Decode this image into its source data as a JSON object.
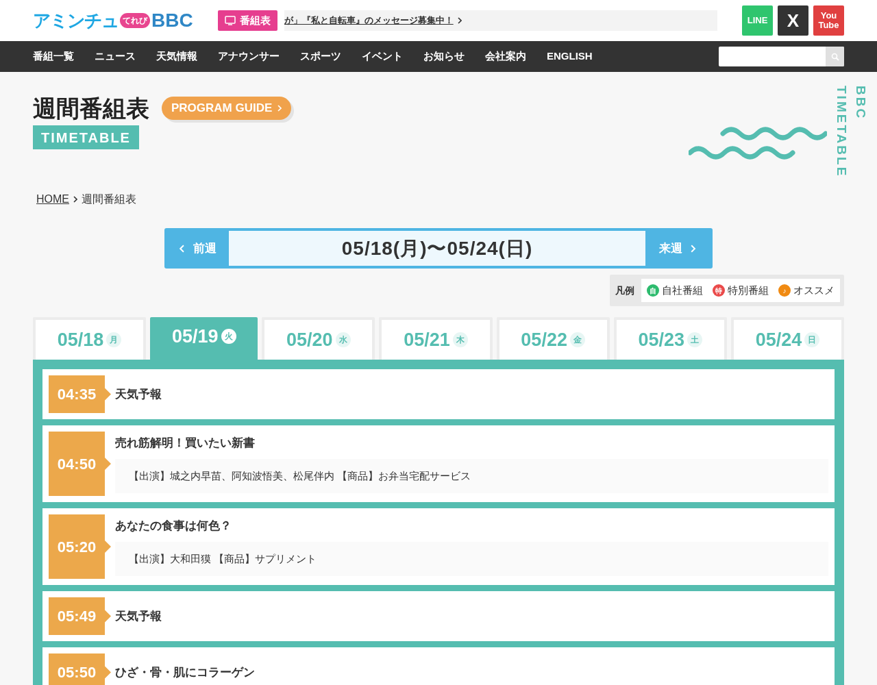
{
  "header": {
    "logo": {
      "main": "アミンチュ",
      "small": "てれび",
      "brand": "BBC"
    },
    "timetable_button": {
      "label": "番組表"
    },
    "ticker": "が」『私と自転車』のメッセージ募集中！",
    "social": [
      {
        "kind": "line",
        "label": "LINE"
      },
      {
        "kind": "x",
        "label": "X"
      },
      {
        "kind": "youtube",
        "label": "You Tube"
      }
    ]
  },
  "nav": {
    "items": [
      "番組一覧",
      "ニュース",
      "天気情報",
      "アナウンサー",
      "スポーツ",
      "イベント",
      "お知らせ",
      "会社案内",
      "ENGLISH"
    ]
  },
  "hero": {
    "title": "週間番組表",
    "guide_button": "PROGRAM GUIDE",
    "subtitle": "TIMETABLE",
    "side_text": "BBC TIMETABLE"
  },
  "breadcrumb": {
    "home": "HOME",
    "current": "週間番組表"
  },
  "week_nav": {
    "prev": "前週",
    "range": "05/18(月)〜05/24(日)",
    "next": "来週"
  },
  "legend": {
    "label": "凡例",
    "items": [
      {
        "mark": "自",
        "label": "自社番組",
        "color": "#2dbb6e"
      },
      {
        "mark": "特",
        "label": "特別番組",
        "color": "#ea4a4a"
      },
      {
        "mark": "♪",
        "label": "オススメ",
        "color": "#f08a12"
      }
    ]
  },
  "day_tabs": [
    {
      "date": "05/18",
      "day": "月",
      "selected": false
    },
    {
      "date": "05/19",
      "day": "火",
      "selected": true
    },
    {
      "date": "05/20",
      "day": "水",
      "selected": false
    },
    {
      "date": "05/21",
      "day": "木",
      "selected": false
    },
    {
      "date": "05/22",
      "day": "金",
      "selected": false
    },
    {
      "date": "05/23",
      "day": "土",
      "selected": false
    },
    {
      "date": "05/24",
      "day": "日",
      "selected": false
    }
  ],
  "programs": [
    {
      "time": "04:35",
      "title": "天気予報"
    },
    {
      "time": "04:50",
      "title": "売れ筋解明！買いたい新書",
      "details": "【出演】城之内早苗、阿知波悟美、松尾伴内 【商品】お弁当宅配サービス"
    },
    {
      "time": "05:20",
      "title": "あなたの食事は何色？",
      "details": "【出演】大和田獏 【商品】サプリメント"
    },
    {
      "time": "05:49",
      "title": "天気予報"
    },
    {
      "time": "05:50",
      "title": "ひざ・骨・肌にコラーゲン"
    }
  ]
}
